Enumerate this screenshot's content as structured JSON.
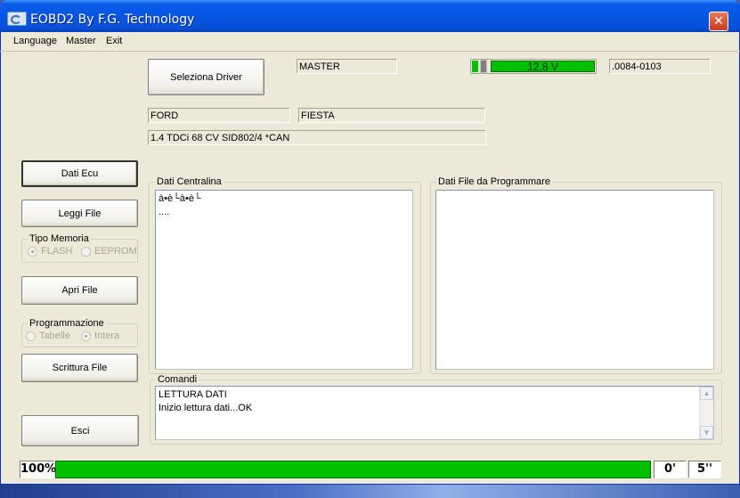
{
  "window": {
    "title": "EOBD2 By F.G. Technology",
    "close_glyph": "✕"
  },
  "menu": [
    "Language",
    "Master",
    "Exit"
  ],
  "top": {
    "select_driver_label": "Seleziona Driver",
    "master_value": "MASTER",
    "voltage": {
      "display": "12,8 V",
      "color": "#00c000"
    },
    "version_value": ".0084-0103",
    "brand_value": "FORD",
    "model_value": "FIESTA",
    "engine_value": "1.4 TDCi 68 CV  SID802/4 *CAN"
  },
  "left_buttons": {
    "dati_ecu": "Dati Ecu",
    "leggi_file": "Leggi File",
    "apri_file": "Apri File",
    "scrittura_file": "Scrittura File",
    "esci": "Esci"
  },
  "tipo_memoria": {
    "label": "Tipo Memoria",
    "options": [
      "FLASH",
      "EEPROM"
    ],
    "selected": "FLASH"
  },
  "programmazione": {
    "label": "Programmazione",
    "options": [
      "Tabelle",
      "Intera"
    ],
    "selected": "Intera"
  },
  "dati_centralina": {
    "label": "Dati Centralina",
    "lines": [
      "à•è└à•è└",
      "...."
    ]
  },
  "dati_file": {
    "label": "Dati File da Programmare",
    "lines": []
  },
  "comandi": {
    "label": "Comandi",
    "lines": [
      "LETTURA DATI",
      "Inizio lettura dati...OK"
    ]
  },
  "status": {
    "percent": "100%",
    "progress": 1.0,
    "progress_color": "#00c000",
    "time_elapsed": "0'",
    "time_remaining": "5''"
  }
}
